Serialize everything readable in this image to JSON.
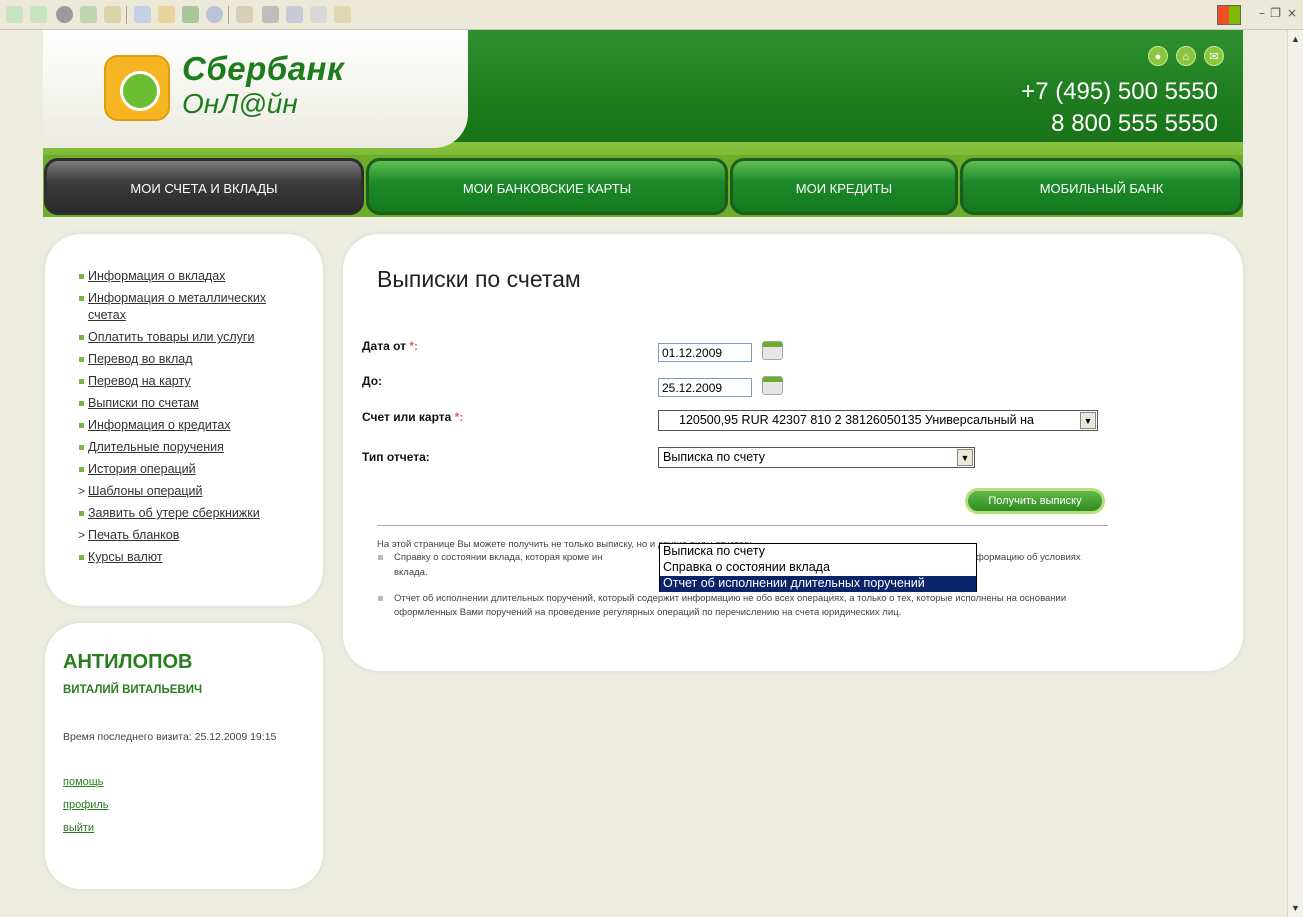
{
  "browser": {
    "window_controls": [
      "–",
      "❐",
      "×"
    ]
  },
  "header": {
    "logo_line1": "Сбербанк",
    "logo_line2": "ОнЛ@йн",
    "phone1": "+7 (495) 500 5550",
    "phone2": "8 800 555 5550"
  },
  "nav": {
    "tabs": [
      {
        "label": "МОИ СЧЕТА И ВКЛАДЫ",
        "active": true
      },
      {
        "label": "МОИ БАНКОВСКИЕ КАРТЫ",
        "active": false
      },
      {
        "label": "МОИ КРЕДИТЫ",
        "active": false
      },
      {
        "label": "МОБИЛЬНЫЙ БАНК",
        "active": false
      }
    ]
  },
  "sidebar": {
    "items": [
      {
        "label": "Информация о вкладах",
        "marker": "bullet"
      },
      {
        "label": "Информация о металлических счетах",
        "marker": "bullet"
      },
      {
        "label": "Оплатить товары или услуги",
        "marker": "bullet"
      },
      {
        "label": "Перевод во вклад",
        "marker": "bullet"
      },
      {
        "label": "Перевод на карту",
        "marker": "bullet"
      },
      {
        "label": "Выписки по счетам",
        "marker": "bullet"
      },
      {
        "label": "Информация о кредитах",
        "marker": "bullet"
      },
      {
        "label": "Длительные поручения",
        "marker": "bullet"
      },
      {
        "label": "История операций",
        "marker": "bullet"
      },
      {
        "label": "Шаблоны операций",
        "marker": "chevron"
      },
      {
        "label": "Заявить об утере сберкнижки",
        "marker": "bullet"
      },
      {
        "label": "Печать бланков",
        "marker": "chevron"
      },
      {
        "label": "Курсы валют",
        "marker": "bullet"
      }
    ]
  },
  "user": {
    "last_name": "АНТИЛОПОВ",
    "first_patronymic": "ВИТАЛИЙ ВИТАЛЬЕВИЧ",
    "last_visit": "Время последнего визита: 25.12.2009 19:15",
    "links": [
      "помощь",
      "профиль",
      "выйти"
    ]
  },
  "main": {
    "title": "Выписки по счетам",
    "date_from_label": "Дата от",
    "date_from_value": "01.12.2009",
    "date_to_label": "До:",
    "date_to_value": "25.12.2009",
    "account_label": "Счет или карта",
    "account_value": "120500,95 RUR 42307 810 2 38126050135 Универсальный на",
    "report_type_label": "Тип отчета:",
    "report_type_value": "Выписка по счету",
    "report_options": [
      "Выписка по счету",
      "Справка о состоянии вклада",
      "Отчет об исполнении длительных поручений"
    ],
    "report_selected_index": 2,
    "submit_button": "Получить выписку",
    "required_mark": "*:",
    "notes_intro": "На этой странице Вы можете получить не только выписку, но и другие виды отчетов:",
    "note1_start": "Справку о состоянии вклада, которая кроме ин",
    "note1_end": "формацию об условиях",
    "note1_line2": "вклада.",
    "note2": "Отчет об исполнении длительных поручений, который содержит информацию не обо всех операциях, а только о тех, которые исполнены на основании оформленных Вами поручений на проведение регулярных операций по перечислению на счета юридических лиц."
  },
  "colors": {
    "brand_green": "#1d7d1d",
    "light_green": "#6cae2a",
    "selection_blue": "#0a246a"
  }
}
